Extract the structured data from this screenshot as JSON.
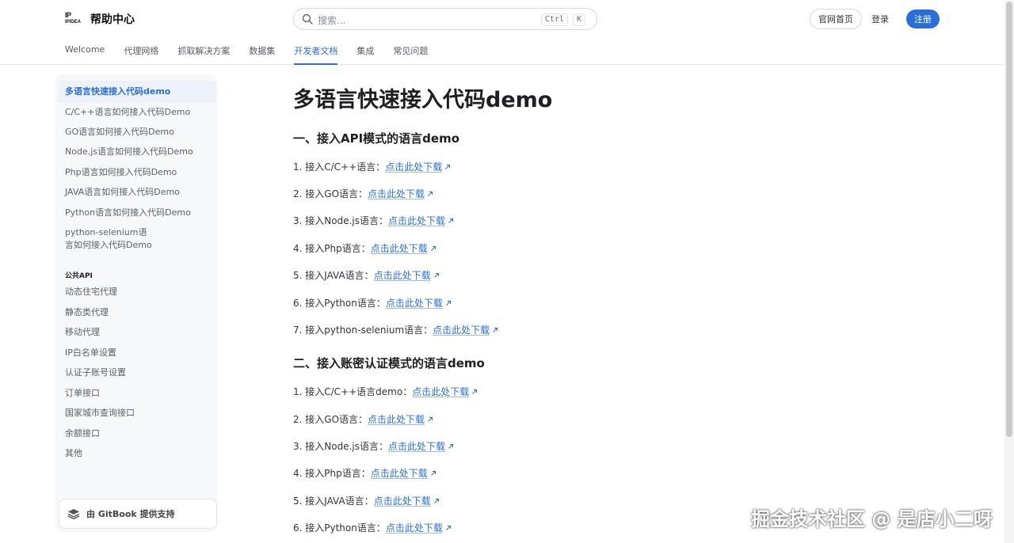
{
  "header": {
    "logo_mark": "IP",
    "logo_sub": "IPIDEA",
    "title": "帮助中心",
    "search_placeholder": "搜索...",
    "kbd_ctrl": "Ctrl",
    "kbd_k": "K",
    "home_button": "官网首页",
    "login_button": "登录",
    "register_button": "注册",
    "accent_color": "#2b6fd6"
  },
  "tabs": [
    {
      "label": "Welcome"
    },
    {
      "label": "代理网络"
    },
    {
      "label": "抓取解决方案"
    },
    {
      "label": "数据集"
    },
    {
      "label": "开发者文档",
      "active": true
    },
    {
      "label": "集成"
    },
    {
      "label": "常见问题"
    }
  ],
  "sidebar": {
    "items": [
      {
        "label": "多语言快速接入代码demo",
        "active": true
      },
      {
        "label": "C/C++语言如何接入代码Demo"
      },
      {
        "label": "GO语言如何接入代码Demo"
      },
      {
        "label": "Node.js语言如何接入代码Demo"
      },
      {
        "label": "Php语言如何接入代码Demo"
      },
      {
        "label": "JAVA语言如何接入代码Demo"
      },
      {
        "label": "Python语言如何接入代码Demo"
      },
      {
        "label": "python-selenium语言如何接入代码Demo"
      }
    ],
    "section_title": "公共API",
    "api_items": [
      {
        "label": "动态住宅代理"
      },
      {
        "label": "静态类代理"
      },
      {
        "label": "移动代理"
      },
      {
        "label": "IP白名单设置"
      },
      {
        "label": "认证子账号设置"
      },
      {
        "label": "订单接口"
      },
      {
        "label": "国家城市查询接口"
      },
      {
        "label": "余额接口"
      },
      {
        "label": "其他"
      }
    ],
    "gitbook_label": "由 GitBook 提供支持"
  },
  "main": {
    "title": "多语言快速接入代码demo",
    "section1": {
      "heading": "一、接入API模式的语言demo",
      "rows": [
        {
          "text": "1. 接入C/C++语言：",
          "link": "点击此处下载"
        },
        {
          "text": "2. 接入GO语言：",
          "link": "点击此处下载"
        },
        {
          "text": "3. 接入Node.js语言：",
          "link": "点击此处下载"
        },
        {
          "text": "4. 接入Php语言：",
          "link": "点击此处下载"
        },
        {
          "text": "5. 接入JAVA语言：",
          "link": "点击此处下载"
        },
        {
          "text": "6. 接入Python语言：",
          "link": "点击此处下载"
        },
        {
          "text": "7. 接入python-selenium语言：",
          "link": "点击此处下载"
        }
      ]
    },
    "section2": {
      "heading": "二、接入账密认证模式的语言demo",
      "rows": [
        {
          "text": "1. 接入C/C++语言demo：",
          "link": "点击此处下载"
        },
        {
          "text": "2. 接入GO语言：",
          "link": "点击此处下载"
        },
        {
          "text": "3. 接入Node.js语言：",
          "link": "点击此处下载"
        },
        {
          "text": "4. 接入Php语言：",
          "link": "点击此处下载"
        },
        {
          "text": "5. 接入JAVA语言：",
          "link": "点击此处下载"
        },
        {
          "text": "6. 接入Python语言：",
          "link": "点击此处下载"
        }
      ]
    }
  },
  "watermark": "掘金技术社区 @ 是店小二呀"
}
